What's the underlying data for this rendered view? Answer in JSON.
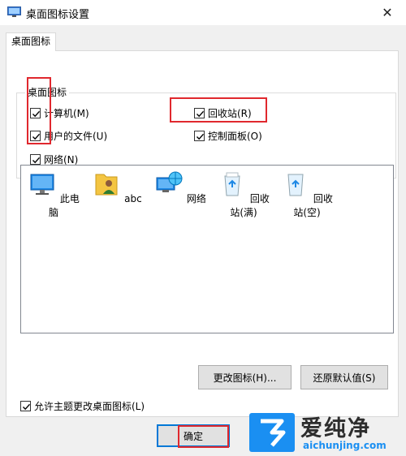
{
  "window": {
    "title": "桌面图标设置",
    "close_glyph": "✕",
    "icon": "display-settings-icon"
  },
  "tab": {
    "label": "桌面图标"
  },
  "group": {
    "title": "桌面图标",
    "checkboxes": [
      {
        "label": "计算机(M)",
        "checked": true
      },
      {
        "label": "用户的文件(U)",
        "checked": true
      },
      {
        "label": "网络(N)",
        "checked": true
      },
      {
        "label": "回收站(R)",
        "checked": true
      },
      {
        "label": "控制面板(O)",
        "checked": true
      }
    ]
  },
  "icons": [
    {
      "label": "此电脑",
      "icon": "computer-icon"
    },
    {
      "label": "abc",
      "icon": "user-folder-icon"
    },
    {
      "label": "网络",
      "icon": "network-icon"
    },
    {
      "label": "回收站(满)",
      "icon": "recycle-bin-full-icon"
    },
    {
      "label": "回收站(空)",
      "icon": "recycle-bin-empty-icon"
    }
  ],
  "buttons": {
    "change_icon": "更改图标(H)...",
    "restore_default": "还原默认值(S)",
    "ok": "确定"
  },
  "allow_themes": {
    "label": "允许主题更改桌面图标(L)",
    "checked": true
  },
  "watermark": {
    "brand": "爱纯净",
    "url": "aichunjing.com",
    "logo": "brand-logo-icon"
  },
  "colors": {
    "highlight": "#e0282e",
    "brand_blue": "#1a8ff2"
  }
}
